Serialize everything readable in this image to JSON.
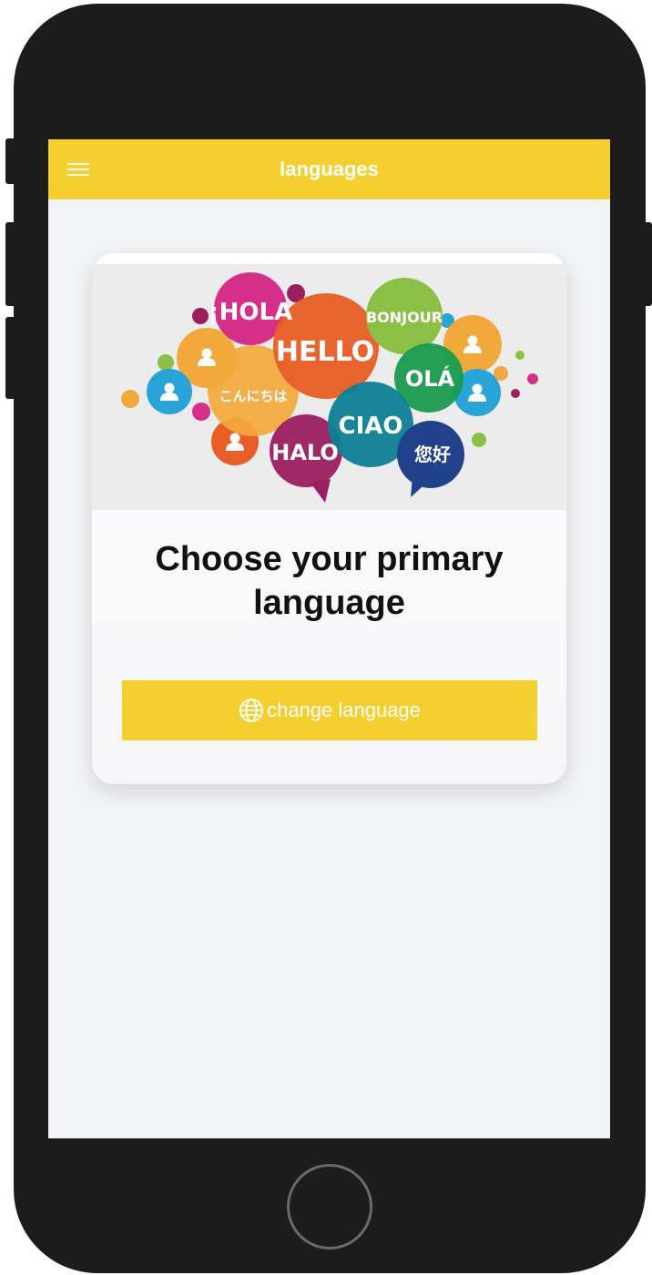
{
  "appbar": {
    "title": "languages",
    "menu_icon": "hamburger-menu-icon"
  },
  "hero": {
    "greetings": [
      "¡HOLA",
      "HELLO",
      "BONJOUR",
      "OLÁ",
      "こんにちは",
      "CIAO",
      "HALO",
      "您好"
    ],
    "icon": "person-icon"
  },
  "card": {
    "title": "Choose your primary language",
    "button_label": "change language",
    "button_icon": "globe-icon"
  },
  "colors": {
    "accent": "#f5cf2f",
    "frame": "#1c1c1c",
    "screen_bg": "#f2f3f7"
  }
}
